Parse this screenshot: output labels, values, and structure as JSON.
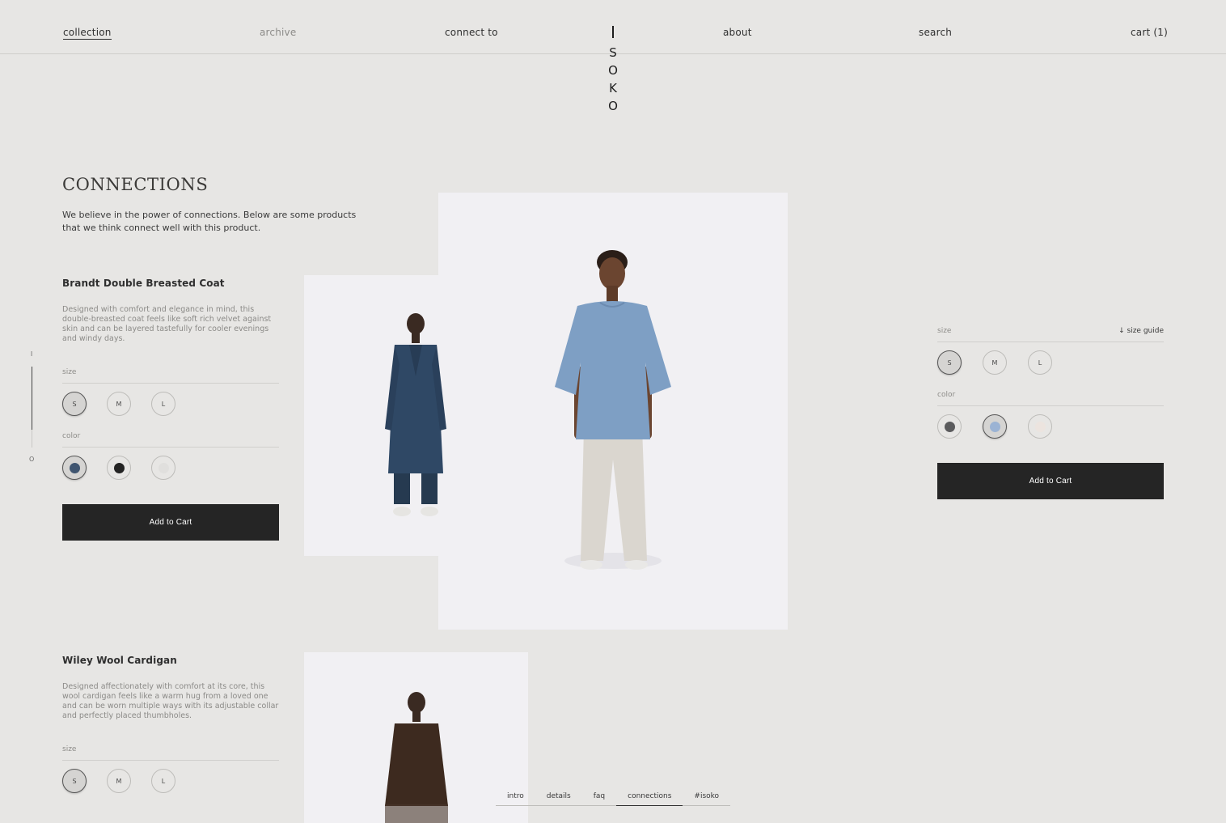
{
  "nav": {
    "collection": "collection",
    "archive": "archive",
    "connect_to": "connect to",
    "about": "about",
    "search": "search",
    "cart": "cart (1)"
  },
  "logo": [
    "I",
    "S",
    "O",
    "K",
    "O"
  ],
  "section": {
    "title": "CONNECTIONS",
    "description": "We believe in the power of connections. Below are some products that we think connect well with this product."
  },
  "products": [
    {
      "name": "Brandt Double Breasted Coat",
      "description": "Designed with comfort and elegance in mind, this double-breasted coat feels like soft rich velvet against skin and can be layered tastefully for cooler evenings and windy days.",
      "size_label": "size",
      "sizes": [
        "S",
        "M",
        "L"
      ],
      "selected_size": "S",
      "color_label": "color",
      "colors": [
        "#3f5570",
        "#232323",
        "#e0dfdd"
      ],
      "selected_color": 0,
      "add_to_cart": "Add to Cart"
    },
    {
      "name": "Wiley Wool Cardigan",
      "description": "Designed affectionately with comfort at its core, this wool cardigan feels like a warm hug from a loved one and can be worn multiple ways with its adjustable collar and perfectly placed thumbholes.",
      "size_label": "size",
      "sizes": [
        "S",
        "M",
        "L"
      ],
      "selected_size": "S"
    }
  ],
  "main_product": {
    "size_label": "size",
    "size_guide": "size guide",
    "sizes": [
      "S",
      "M",
      "L"
    ],
    "selected_size": "S",
    "color_label": "color",
    "colors": [
      "#5b5b5d",
      "#9bb3d4",
      "#ece4df"
    ],
    "selected_color": 1,
    "add_to_cart": "Add to Cart"
  },
  "progress": {
    "start": "I",
    "end": "O"
  },
  "tabs": [
    "intro",
    "details",
    "faq",
    "connections",
    "#isoko"
  ],
  "active_tab": "connections"
}
